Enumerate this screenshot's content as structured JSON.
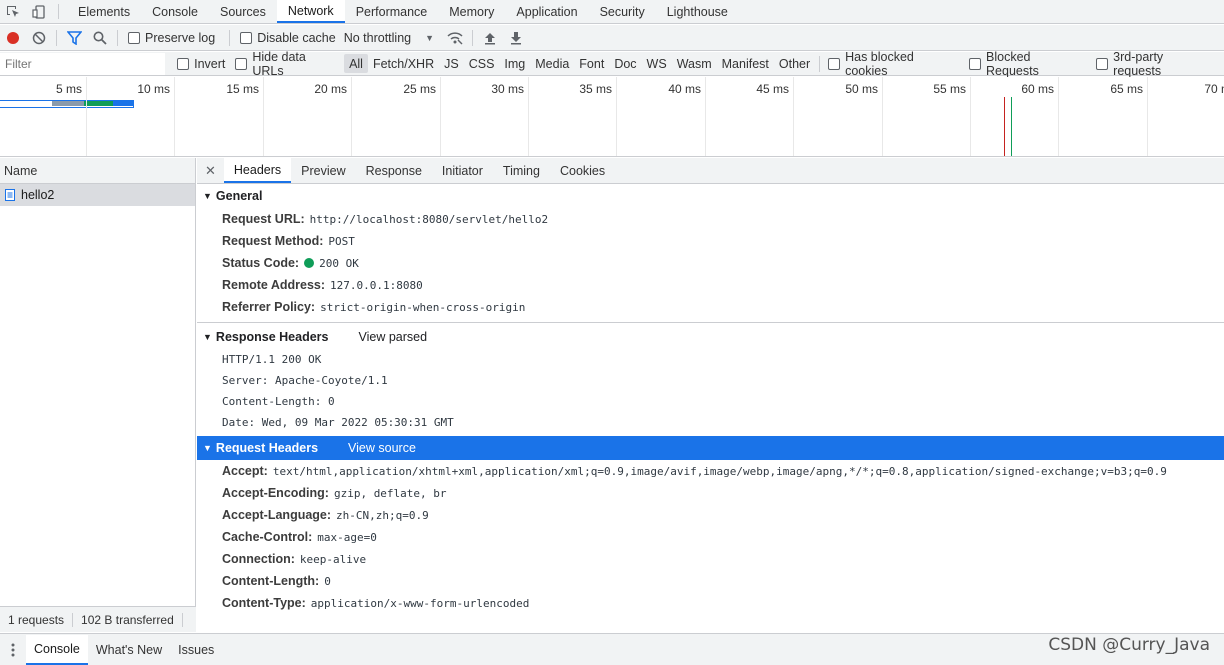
{
  "tabs": [
    "Elements",
    "Console",
    "Sources",
    "Network",
    "Performance",
    "Memory",
    "Application",
    "Security",
    "Lighthouse"
  ],
  "active_tab": "Network",
  "toolbar": {
    "preserve_log": "Preserve log",
    "disable_cache": "Disable cache",
    "throttling": "No throttling"
  },
  "filter": {
    "placeholder": "Filter",
    "invert": "Invert",
    "hide_data_urls": "Hide data URLs",
    "types": [
      "All",
      "Fetch/XHR",
      "JS",
      "CSS",
      "Img",
      "Media",
      "Font",
      "Doc",
      "WS",
      "Wasm",
      "Manifest",
      "Other"
    ],
    "has_blocked_cookies": "Has blocked cookies",
    "blocked_requests": "Blocked Requests",
    "third_party": "3rd-party requests"
  },
  "overview": {
    "ticks": [
      "5 ms",
      "10 ms",
      "15 ms",
      "20 ms",
      "25 ms",
      "30 ms",
      "35 ms",
      "40 ms",
      "45 ms",
      "50 ms",
      "55 ms",
      "60 ms",
      "65 ms",
      "70 m"
    ]
  },
  "left": {
    "name_header": "Name",
    "request_name": "hello2",
    "footer_requests": "1 requests",
    "footer_transferred": "102 B transferred"
  },
  "detail_tabs": [
    "Headers",
    "Preview",
    "Response",
    "Initiator",
    "Timing",
    "Cookies"
  ],
  "general": {
    "title": "General",
    "rows": [
      {
        "name": "Request URL:",
        "value": "http://localhost:8080/servlet/hello2"
      },
      {
        "name": "Request Method:",
        "value": "POST"
      },
      {
        "name": "Status Code:",
        "value": "200 OK"
      },
      {
        "name": "Remote Address:",
        "value": "127.0.0.1:8080"
      },
      {
        "name": "Referrer Policy:",
        "value": "strict-origin-when-cross-origin"
      }
    ]
  },
  "response_headers": {
    "title": "Response Headers",
    "link": "View parsed",
    "lines": [
      "HTTP/1.1 200 OK",
      "Server: Apache-Coyote/1.1",
      "Content-Length: 0",
      "Date: Wed, 09 Mar 2022 05:30:31 GMT"
    ]
  },
  "request_headers": {
    "title": "Request Headers",
    "link": "View source",
    "rows": [
      {
        "name": "Accept:",
        "value": "text/html,application/xhtml+xml,application/xml;q=0.9,image/avif,image/webp,image/apng,*/*;q=0.8,application/signed-exchange;v=b3;q=0.9"
      },
      {
        "name": "Accept-Encoding:",
        "value": "gzip, deflate, br"
      },
      {
        "name": "Accept-Language:",
        "value": "zh-CN,zh;q=0.9"
      },
      {
        "name": "Cache-Control:",
        "value": "max-age=0"
      },
      {
        "name": "Connection:",
        "value": "keep-alive"
      },
      {
        "name": "Content-Length:",
        "value": "0"
      },
      {
        "name": "Content-Type:",
        "value": "application/x-www-form-urlencoded"
      }
    ]
  },
  "drawer": {
    "tabs": [
      "Console",
      "What's New",
      "Issues"
    ]
  },
  "watermark": "CSDN @Curry_Java",
  "colors": {
    "accent": "#1a73e8",
    "record": "#d93025",
    "status_ok": "#0f9d58"
  }
}
